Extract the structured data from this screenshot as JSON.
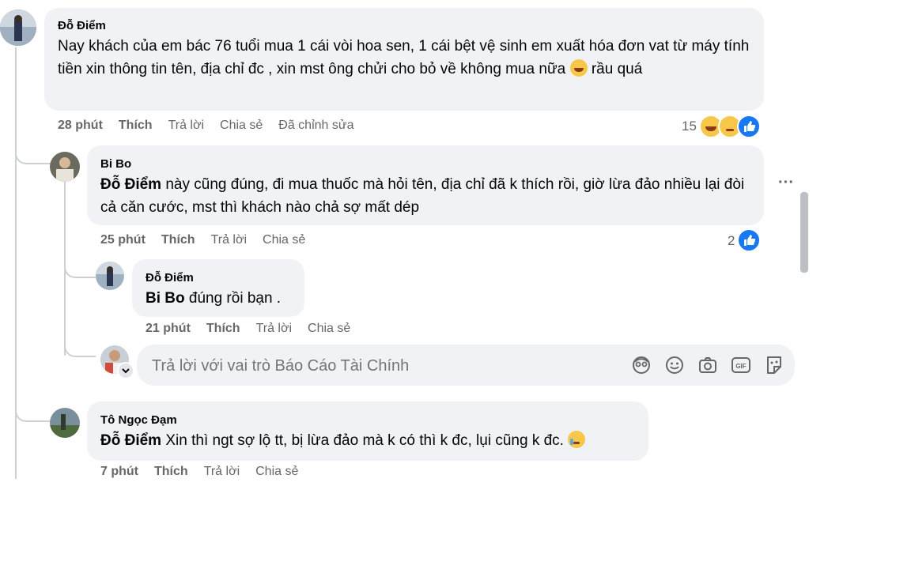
{
  "comments": [
    {
      "author": "Đỗ Điểm",
      "text": "Nay khách của em bác 76 tuổi mua 1 cái vòi hoa sen, 1 cái bệt vệ sinh em xuất hóa đơn vat từ máy tính tiền xin thông tin tên, địa chỉ đc , xin mst ông chửi cho bỏ về không mua nữa",
      "text_end": "rầu quá",
      "emoji": "rolling-laughing-emoji",
      "time": "28 phút",
      "like": "Thích",
      "reply": "Trả lời",
      "share": "Chia sẻ",
      "edited": "Đã chỉnh sửa",
      "reaction_count": "15",
      "reaction_icons": [
        "haha-reaction-icon",
        "sad-reaction-icon",
        "like-reaction-icon"
      ]
    },
    {
      "author": "Bi Bo",
      "mention": "Đỗ Điểm",
      "text": "này cũng đúng, đi mua thuốc mà hỏi tên, địa chỉ đã k thích rồi, giờ lừa đảo nhiều lại đòi cả căn cước, mst thì khách nào chả sợ mất dép",
      "time": "25 phút",
      "like": "Thích",
      "reply": "Trả lời",
      "share": "Chia sẻ",
      "reaction_count": "2",
      "reaction_icons": [
        "like-reaction-icon"
      ],
      "more": "···"
    },
    {
      "author": "Đỗ Điểm",
      "mention": "Bi Bo",
      "text": "đúng rồi bạn .",
      "time": "21 phút",
      "like": "Thích",
      "reply": "Trả lời",
      "share": "Chia sẻ"
    },
    {
      "author": "Tô Ngọc Đạm",
      "mention": "Đỗ Điểm",
      "text": "Xin thì ngt sợ lộ tt, bị lừa đảo mà k có thì k đc, lụi cũng k đc.",
      "emoji": "crying-emoji",
      "time": "7 phút",
      "like": "Thích",
      "reply": "Trả lời",
      "share": "Chia sẻ"
    }
  ],
  "reply_box": {
    "placeholder": "Trả lời với vai trò Báo Cáo Tài Chính",
    "icons": [
      "avatar-sticker-icon",
      "emoji-icon",
      "camera-icon",
      "gif-icon",
      "sticker-icon"
    ]
  },
  "colors": {
    "bubble": "#f0f2f5",
    "meta_text": "#65676b",
    "like_blue": "#1877f2",
    "thread_line": "#ced0d4"
  }
}
